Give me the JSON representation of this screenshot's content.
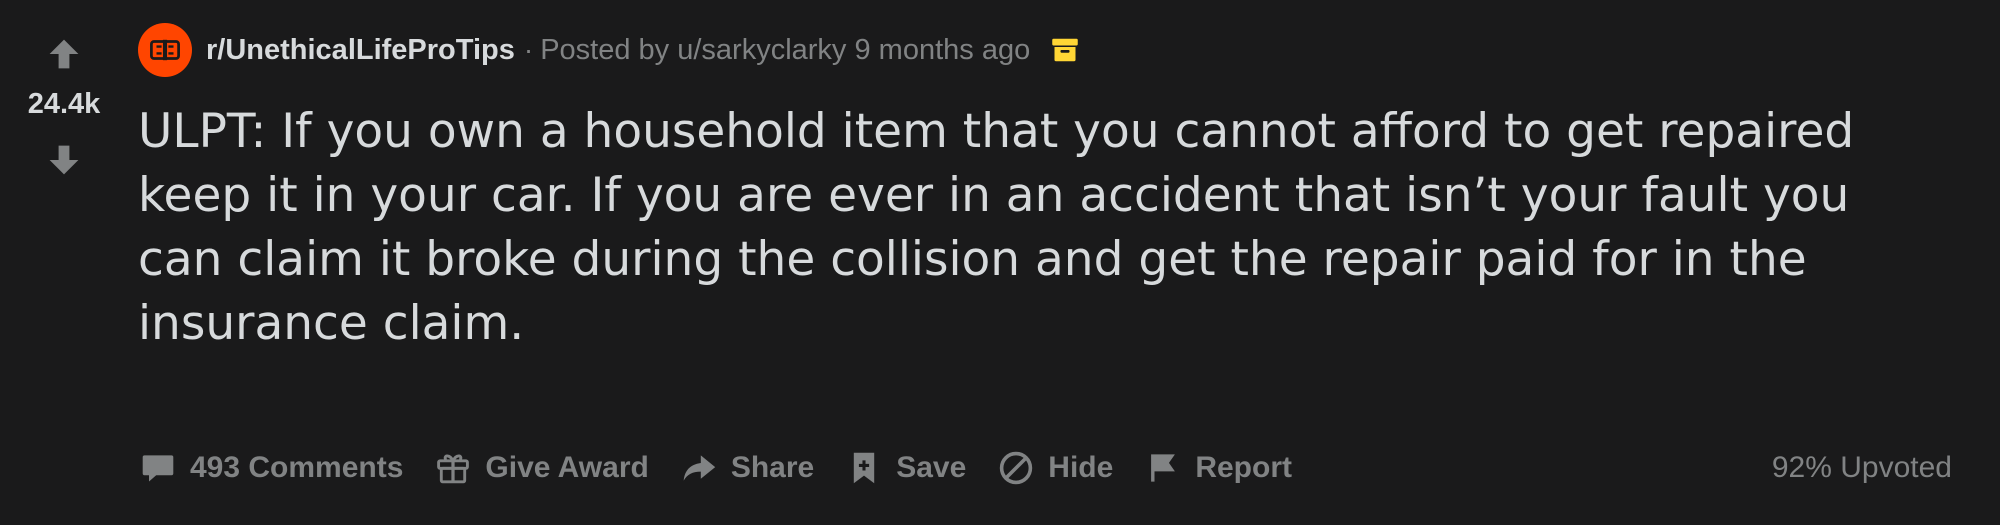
{
  "vote": {
    "count": "24.4k"
  },
  "header": {
    "subreddit": "r/UnethicalLifeProTips",
    "separator": "·",
    "posted_by": "Posted by u/sarkyclarky 9 months ago"
  },
  "post": {
    "title_lines": [
      "ULPT: If you own a household item that you cannot afford to get repaired",
      "keep it in your car. If you are ever in an accident that isn’t your fault you",
      "can claim it broke during the collision and get the repair paid for in the",
      "insurance claim."
    ]
  },
  "actions": {
    "comments": "493 Comments",
    "award": "Give Award",
    "share": "Share",
    "save": "Save",
    "hide": "Hide",
    "report": "Report"
  },
  "stats": {
    "upvoted": "92% Upvoted"
  },
  "colors": {
    "background": "#1a1a1b",
    "text_primary": "#d7dadc",
    "text_muted": "#818384",
    "subreddit_icon": "#ff4500",
    "archive_icon": "#ffd635"
  },
  "icons": {
    "upvote": "arrow-up-icon",
    "downvote": "arrow-down-icon",
    "subreddit": "subreddit-icon",
    "archive": "archive-icon",
    "comments": "comment-icon",
    "award": "gift-icon",
    "share": "share-arrow-icon",
    "save": "bookmark-icon",
    "hide": "hide-icon",
    "report": "flag-icon"
  }
}
